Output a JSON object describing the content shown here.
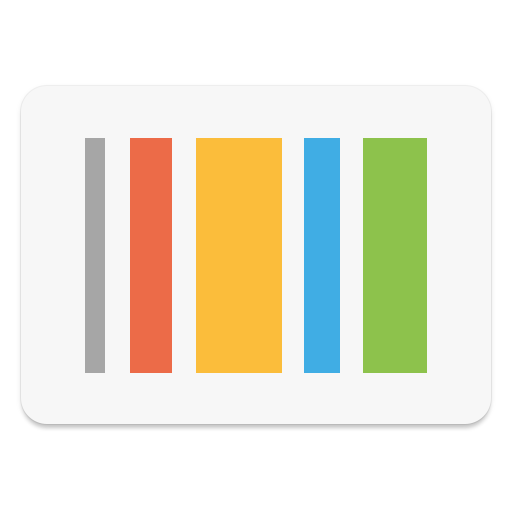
{
  "icon": {
    "name": "barcode-icon",
    "card_color": "#f7f7f7",
    "bar_colors": {
      "gray": "#a6a6a6",
      "orange": "#ec6b48",
      "yellow": "#fbbd3b",
      "blue": "#40ade4",
      "green": "#8dc24c"
    }
  }
}
